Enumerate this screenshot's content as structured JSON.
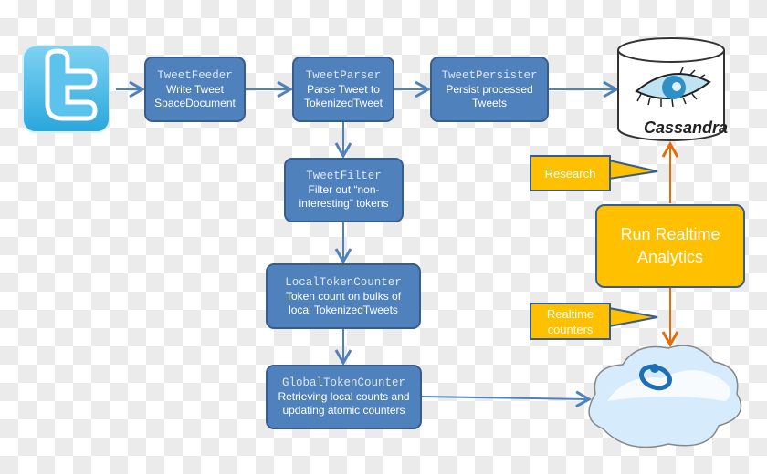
{
  "nodes": {
    "feeder": {
      "name": "TweetFeeder",
      "desc": [
        "Write Tweet",
        "SpaceDocument"
      ]
    },
    "parser": {
      "name": "TweetParser",
      "desc": [
        "Parse Tweet to",
        "TokenizedTweet"
      ]
    },
    "persister": {
      "name": "TweetPersister",
      "desc": [
        "Persist processed",
        "Tweets"
      ]
    },
    "filter": {
      "name": "TweetFilter",
      "desc": [
        "Filter out “non-",
        "interesting” tokens"
      ]
    },
    "local": {
      "name": "LocalTokenCounter",
      "desc": [
        "Token count on bulks of",
        "local TokenizedTweets"
      ]
    },
    "global": {
      "name": "GlobalTokenCounter",
      "desc": [
        "Retrieving local counts and",
        "updating atomic counters"
      ]
    }
  },
  "cassandra": {
    "label": "Cassandra"
  },
  "analytics": {
    "label": [
      "Run Realtime",
      "Analytics"
    ]
  },
  "callouts": {
    "research": [
      "Research"
    ],
    "counters": [
      "Realtime",
      "counters"
    ]
  },
  "icons": {
    "source": "twitter-logo-icon",
    "db": "cassandra-eye-icon",
    "cloud": "cloud-icon"
  },
  "colors": {
    "process": "#4f81bd",
    "border": "#385d8a",
    "analytics": "#ffc000",
    "arrow_blue": "#4f81bd",
    "arrow_orange": "#e46c0a"
  }
}
